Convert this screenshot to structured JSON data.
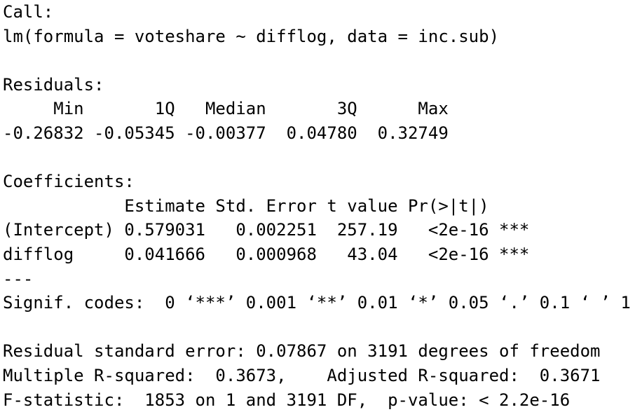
{
  "lines": [
    "Call:",
    "lm(formula = voteshare ~ difflog, data = inc.sub)",
    "",
    "Residuals:",
    "     Min       1Q   Median       3Q      Max ",
    "-0.26832 -0.05345 -0.00377  0.04780  0.32749 ",
    "",
    "Coefficients:",
    "            Estimate Std. Error t value Pr(>|t|)    ",
    "(Intercept) 0.579031   0.002251  257.19   <2e-16 ***",
    "difflog     0.041666   0.000968   43.04   <2e-16 ***",
    "---",
    "Signif. codes:  0 ‘***’ 0.001 ‘**’ 0.01 ‘*’ 0.05 ‘.’ 0.1 ‘ ’ 1",
    "",
    "Residual standard error: 0.07867 on 3191 degrees of freedom",
    "Multiple R-squared:  0.3673,\tAdjusted R-squared:  0.3671 ",
    "F-statistic:  1853 on 1 and 3191 DF,  p-value: < 2.2e-16"
  ]
}
